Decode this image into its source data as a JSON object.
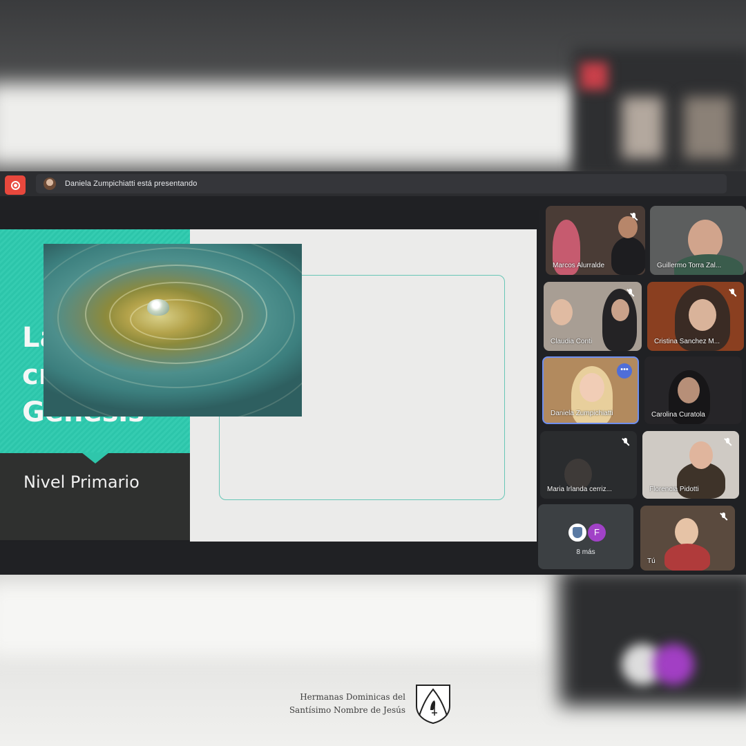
{
  "meeting": {
    "presenting_text": "Daniela Zumpichiatti está presentando"
  },
  "slide": {
    "title_lines": [
      "La",
      "creación",
      "Génesis"
    ],
    "subtitle": "Nivel Primario"
  },
  "participants": [
    {
      "name": "Marcos Alurralde",
      "muted": false
    },
    {
      "name": "Guillermo Torra Zal...",
      "muted": false
    },
    {
      "name": "Claudia Conti",
      "muted": true
    },
    {
      "name": "Cristina Sanchez M...",
      "muted": true
    },
    {
      "name": "Daniela Zumpichiatti",
      "muted": false
    },
    {
      "name": "Carolina Curatola",
      "muted": false
    },
    {
      "name": "Maria Irlanda cerriz...",
      "muted": true
    },
    {
      "name": "Florencia Pidotti",
      "muted": true
    },
    {
      "name": "Tú",
      "muted": true
    }
  ],
  "more_participants": {
    "avatar_letter": "F",
    "label": "8 más"
  },
  "brand": {
    "line1": "Hermanas Dominicas del",
    "line2": "Santísimo Nombre de Jesús"
  },
  "colors": {
    "slide_teal": "#2cc5aa",
    "record_red": "#e8483d",
    "avatar_purple": "#a142c7",
    "active_speaker_blue": "#4f6ed8"
  }
}
